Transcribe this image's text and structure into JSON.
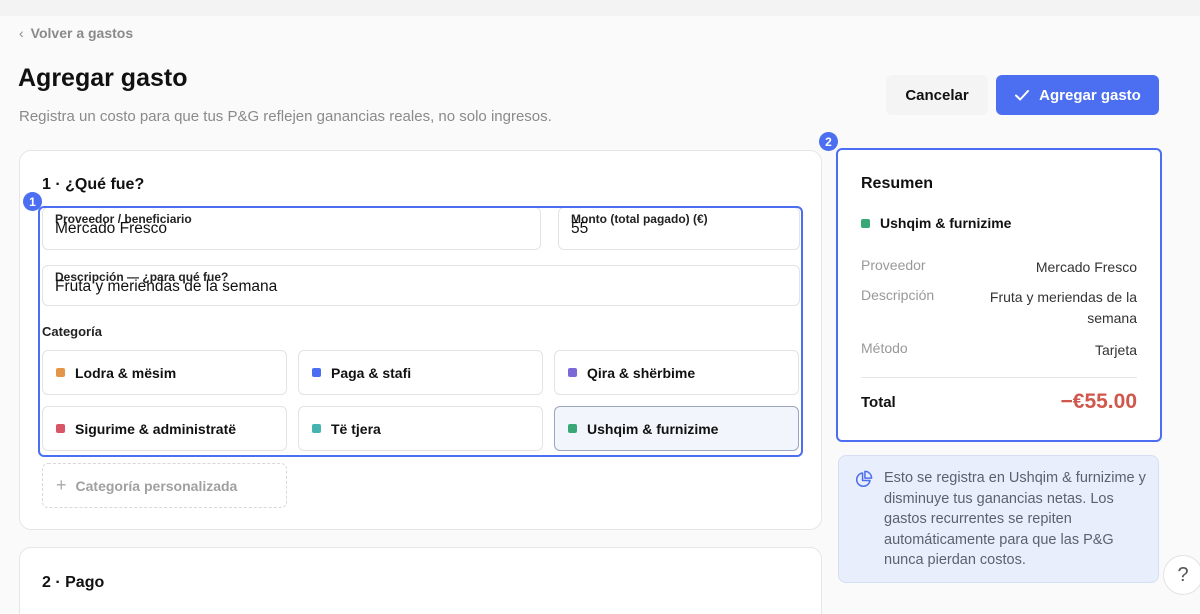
{
  "nav": {
    "back_label": "Volver a gastos"
  },
  "header": {
    "title": "Agregar gasto",
    "subtitle": "Registra un costo para que tus P&G reflejen ganancias reales, no solo ingresos.",
    "cancel_label": "Cancelar",
    "submit_label": "Agregar gasto"
  },
  "section1": {
    "title": "1 · ¿Qué fue?",
    "highlight_badge": "1",
    "vendor": {
      "label": "Proveedor / beneficiario",
      "value": "Mercado Fresco"
    },
    "amount": {
      "label": "Monto (total pagado) (€)",
      "value": "55"
    },
    "description": {
      "label": "Descripción — ¿para qué fue?",
      "value": "Fruta y meriendas de la semana"
    },
    "category_label": "Categoría",
    "categories": [
      {
        "label": "Lodra & mësim",
        "color": "#e3964a"
      },
      {
        "label": "Paga & stafi",
        "color": "#4c6ef0"
      },
      {
        "label": "Qira & shërbime",
        "color": "#7b6ad6"
      },
      {
        "label": "Sigurime & administratë",
        "color": "#d85566"
      },
      {
        "label": "Të tjera",
        "color": "#45b3b0"
      },
      {
        "label": "Ushqim & furnizime",
        "color": "#3aa876",
        "selected": true
      }
    ],
    "custom_category_label": "Categoría personalizada"
  },
  "section2": {
    "title": "2 · Pago"
  },
  "summary": {
    "highlight_badge": "2",
    "title": "Resumen",
    "category": "Ushqim & furnizime",
    "category_color": "#3aa876",
    "vendor_key": "Proveedor",
    "vendor_value": "Mercado Fresco",
    "description_key": "Descripción",
    "description_value": "Fruta y meriendas de la semana",
    "method_key": "Método",
    "method_value": "Tarjeta",
    "total_key": "Total",
    "total_value": "−€55.00"
  },
  "info": {
    "icon": "pie-chart-icon",
    "text": "Esto se registra en Ushqim & furnizime y disminuye tus ganancias netas. Los gastos recurrentes se repiten automáticamente para que las P&G nunca pierdan costos."
  },
  "help": {
    "label": "?"
  },
  "colors": {
    "accent": "#4c6ef0",
    "negative": "#d0574c"
  }
}
